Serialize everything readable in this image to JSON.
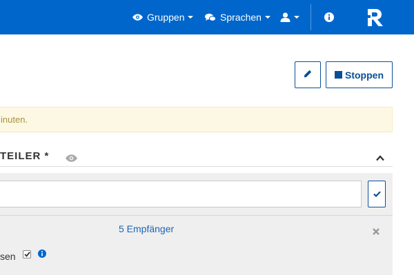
{
  "topbar": {
    "groups_label": "Gruppen",
    "languages_label": "Sprachen"
  },
  "toolbar": {
    "stop_label": "Stoppen"
  },
  "alert": {
    "text": "inuten."
  },
  "section": {
    "title": "TEILER *"
  },
  "recipients": {
    "count_label": "5 Empfänger"
  },
  "option": {
    "label": "sen",
    "checked": true
  },
  "colors": {
    "brand": "#0066cc",
    "accent": "#0a4f96",
    "alert_bg": "#fcf8e3",
    "alert_text": "#a8913e",
    "link": "#1a66b3"
  }
}
